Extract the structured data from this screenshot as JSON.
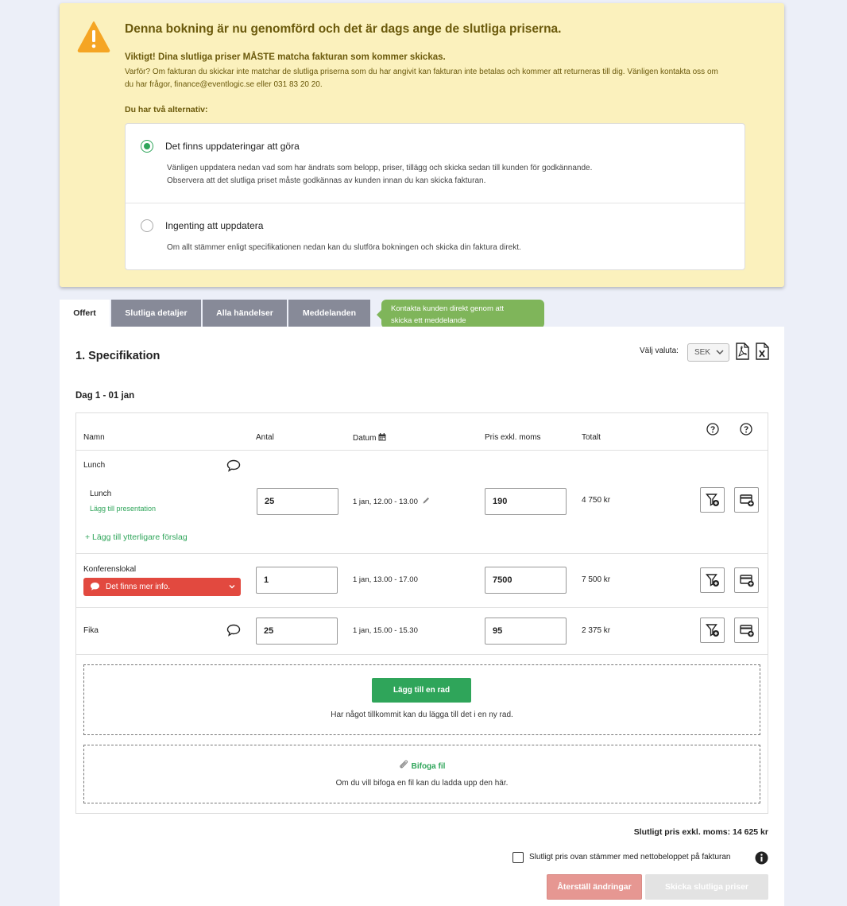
{
  "banner": {
    "title": "Denna bokning är nu genomförd och det är dags ange de slutliga priserna.",
    "subtitle": "Viktigt! Dina slutliga priser MÅSTE matcha fakturan som kommer skickas.",
    "text": "Varför? Om fakturan du skickar inte matchar de slutliga priserna som du har angivit kan fakturan inte betalas och kommer att returneras till dig. Vänligen kontakta oss om du har frågor, finance@eventlogic.se eller 031 83 20 20.",
    "alternatives_label": "Du har två alternativ:",
    "options": [
      {
        "label": "Det finns uppdateringar att göra",
        "desc1": "Vänligen uppdatera nedan vad som har ändrats som belopp, priser, tillägg och skicka sedan till kunden för godkännande.",
        "desc2": "Observera att det slutliga priset måste godkännas av kunden innan du kan skicka fakturan.",
        "selected": true
      },
      {
        "label": "Ingenting att uppdatera",
        "desc1": "Om allt stämmer enligt specifikationen nedan kan du slutföra bokningen och skicka din faktura direkt.",
        "selected": false
      }
    ]
  },
  "tabs": [
    {
      "label": "Offert",
      "active": true
    },
    {
      "label": "Slutliga detaljer",
      "active": false
    },
    {
      "label": "Alla händelser",
      "active": false
    },
    {
      "label": "Meddelanden",
      "active": false
    }
  ],
  "tooltip": {
    "line1": "Kontakta kunden direkt genom att",
    "line2": "skicka ett meddelande"
  },
  "spec": {
    "title": "1. Specifikation",
    "currency_label": "Välj valuta:",
    "currency_value": "SEK",
    "day_title": "Dag 1 - 01 jan"
  },
  "table": {
    "headers": {
      "name": "Namn",
      "qty": "Antal",
      "date": "Datum",
      "price": "Pris exkl. moms",
      "total": "Totalt"
    },
    "lunch": {
      "group": "Lunch",
      "item": "Lunch",
      "add_presentation": "Lägg till presentation",
      "qty": "25",
      "date": "1 jan, 12.00 - 13.00",
      "price": "190",
      "total": "4 750 kr",
      "add_more": "+ Lägg till ytterligare förslag"
    },
    "konferens": {
      "name": "Konferenslokal",
      "more_info": "Det finns mer info.",
      "qty": "1",
      "date": "1 jan, 13.00 - 17.00",
      "price": "7500",
      "total": "7 500 kr"
    },
    "fika": {
      "name": "Fika",
      "qty": "25",
      "date": "1 jan, 15.00 - 15.30",
      "price": "95",
      "total": "2 375 kr"
    },
    "add_row": {
      "button": "Lägg till en rad",
      "text": "Har något tillkommit kan du lägga till det i en ny rad."
    },
    "attach": {
      "link": "Bifoga fil",
      "text": "Om du vill bifoga en fil kan du ladda upp den här."
    }
  },
  "footer": {
    "final_price": "Slutligt pris exkl. moms: 14 625 kr",
    "confirm_label": "Slutligt pris ovan stämmer med nettobeloppet på fakturan",
    "reset_button": "Återställ ändringar",
    "send_button": "Skicka slutliga priser"
  },
  "colors": {
    "accent_green": "#2fa55a",
    "banner_bg": "#fbf1bd",
    "alert_red": "#e2493f",
    "tab_inactive": "#878a98"
  }
}
